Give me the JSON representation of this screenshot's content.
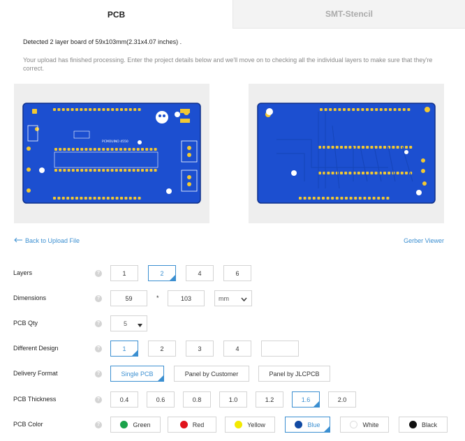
{
  "tabs": [
    {
      "label": "PCB"
    },
    {
      "label": "SMT-Stencil"
    }
  ],
  "detected_text": "Detected 2 layer board of 59x103mm(2.31x4.07 inches) .",
  "info_text": "Your upload has finished processing. Enter the project details below and we'll move on to checking all the individual layers to make sure that they're correct.",
  "board_front": {
    "silkscreen": "PCMOUINO 4550"
  },
  "links": {
    "back": "Back to Upload File",
    "gerber": "Gerber Viewer"
  },
  "form": {
    "layers": {
      "label": "Layers",
      "options": [
        "1",
        "2",
        "4",
        "6"
      ],
      "selected": "2"
    },
    "dimensions": {
      "label": "Dimensions",
      "width": "59",
      "height": "103",
      "times": "*",
      "unit": "mm"
    },
    "qty": {
      "label": "PCB Qty",
      "value": "5"
    },
    "different_design": {
      "label": "Different Design",
      "options": [
        "1",
        "2",
        "3",
        "4"
      ],
      "custom": "",
      "selected": "1"
    },
    "delivery": {
      "label": "Delivery Format",
      "options": [
        "Single PCB",
        "Panel by Customer",
        "Panel by JLCPCB"
      ],
      "selected": "Single PCB"
    },
    "thickness": {
      "label": "PCB Thickness",
      "options": [
        "0.4",
        "0.6",
        "0.8",
        "1.0",
        "1.2",
        "1.6",
        "2.0"
      ],
      "selected": "1.6"
    },
    "color": {
      "label": "PCB Color",
      "options": [
        {
          "name": "Green",
          "color": "#1aa24a"
        },
        {
          "name": "Red",
          "color": "#e0131c"
        },
        {
          "name": "Yellow",
          "color": "#f3e900"
        },
        {
          "name": "Blue",
          "color": "#114aa3"
        },
        {
          "name": "White",
          "color": "#ffffff"
        },
        {
          "name": "Black",
          "color": "#111111"
        }
      ],
      "selected": "Blue"
    }
  },
  "help_glyph": "?",
  "colors": {
    "accent": "#3b8fd1",
    "board": "#1c4fd0",
    "tab_inactive_bg": "#f3f3f3"
  }
}
